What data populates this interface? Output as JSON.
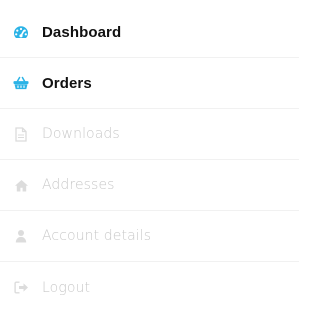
{
  "account_nav": {
    "items": [
      {
        "label": "Dashboard",
        "icon": "dashboard-icon",
        "state": "active",
        "color": "#2bb3e6"
      },
      {
        "label": "Orders",
        "icon": "basket-icon",
        "state": "active",
        "color": "#2bb3e6"
      },
      {
        "label": "Downloads",
        "icon": "file-icon",
        "state": "inactive",
        "color": "#dcdcdc"
      },
      {
        "label": "Addresses",
        "icon": "home-icon",
        "state": "inactive",
        "color": "#dcdcdc"
      },
      {
        "label": "Account details",
        "icon": "user-icon",
        "state": "inactive",
        "color": "#dcdcdc"
      },
      {
        "label": "Logout",
        "icon": "sign-out-icon",
        "state": "inactive",
        "color": "#dcdcdc"
      }
    ]
  }
}
